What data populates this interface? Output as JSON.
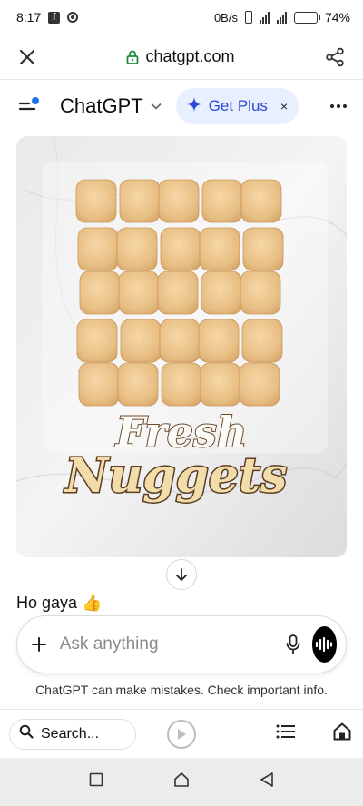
{
  "status_bar": {
    "time": "8:17",
    "net_speed": "0B/s",
    "battery": "74%",
    "battery_level": 0.74
  },
  "url_bar": {
    "domain": "chatgpt.com"
  },
  "header": {
    "app_title": "ChatGPT",
    "get_plus_label": "Get Plus",
    "get_plus_close": "×"
  },
  "image": {
    "line1": "Fresh",
    "line2": "Nuggets"
  },
  "message": {
    "text": "Ho gaya 👍"
  },
  "composer": {
    "placeholder": "Ask anything"
  },
  "disclaimer": "ChatGPT can make mistakes. Check important info.",
  "browser_bar": {
    "search_label": "Search..."
  },
  "icons": {
    "url_bar": [
      "close-icon",
      "lock-icon",
      "share-icon"
    ],
    "header": [
      "menu-icon",
      "chevron-down-icon",
      "sparkle-icon",
      "more-icon"
    ],
    "composer": [
      "plus-icon",
      "mic-icon",
      "voice-icon"
    ],
    "navigation": [
      "search-icon",
      "play-icon",
      "list-icon",
      "home-icon",
      "recents-icon",
      "home-nav-icon",
      "back-icon"
    ]
  },
  "colors": {
    "accent_blue": "#2c49d6",
    "get_plus_bg": "#e8efff",
    "menu_dot": "#1a73e8"
  }
}
